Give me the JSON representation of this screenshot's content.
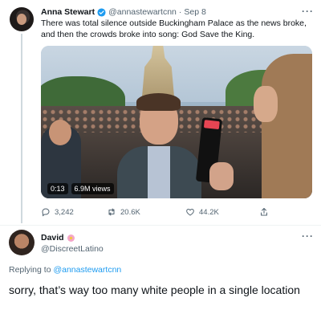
{
  "tweet": {
    "author_name": "Anna Stewart",
    "author_handle": "@annastewartcnn",
    "separator": "·",
    "date": "Sep 8",
    "text": "There was total silence outside Buckingham Palace as the news broke, and then the crowds broke into song: God Save the King.",
    "video": {
      "duration": "0:13",
      "views": "6.9M views"
    },
    "actions": {
      "replies": "3,242",
      "retweets": "20.6K",
      "likes": "44.2K"
    },
    "more_label": "···",
    "verified_icon": "verified-badge-icon",
    "accent_color": "#1d9bf0"
  },
  "reply": {
    "author_name": "David",
    "author_handle": "@DiscreetLatino",
    "more_label": "···",
    "replying_prefix": "Replying to ",
    "replying_to": "@annastewartcnn",
    "text": "sorry, that’s way too many white people in a single location"
  }
}
